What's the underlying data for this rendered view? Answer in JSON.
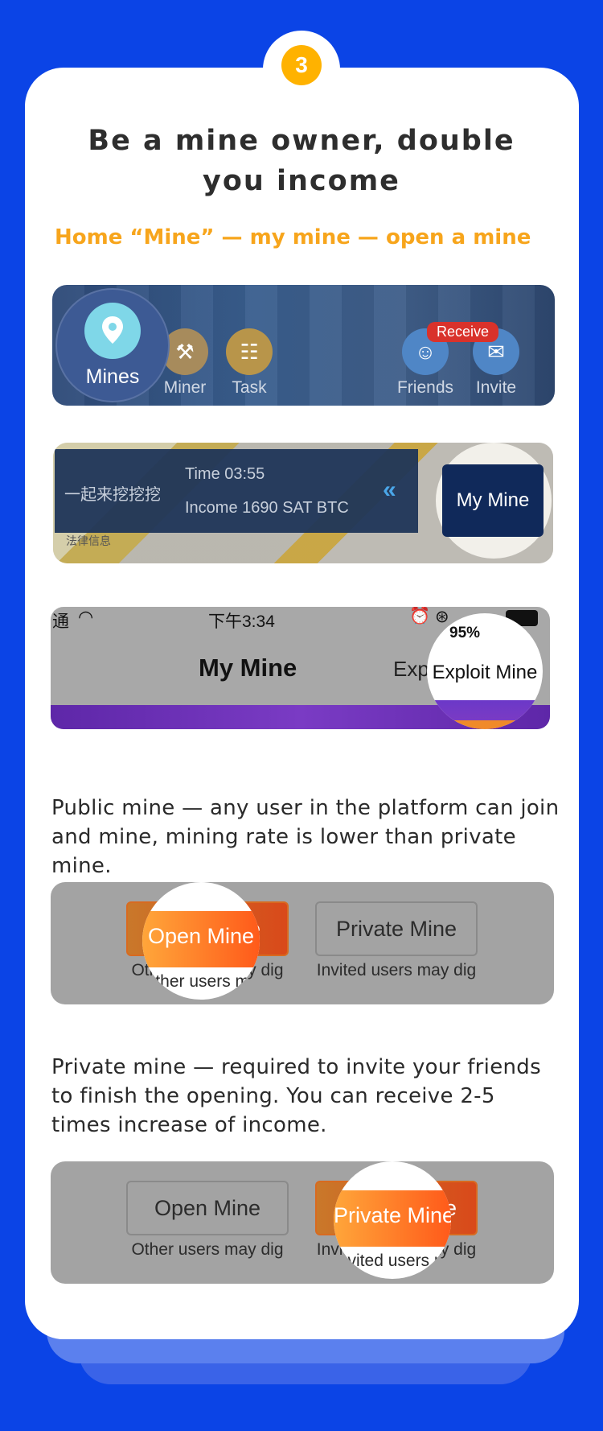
{
  "step": {
    "number": "3"
  },
  "title": "Be a mine owner, double you income",
  "path_hint": "Home “Mine” — my mine — open a mine",
  "nav_bar": {
    "mines": "Mines",
    "miner": "Miner",
    "task": "Task",
    "friends": "Friends",
    "invite": "Invite",
    "receive_badge": "Receive"
  },
  "map_panel": {
    "slogan": "一起来挖挖挖",
    "time": "Time 03:55",
    "income": "Income 1690 SAT BTC",
    "legal": "法律信息",
    "my_mine_button": "My Mine"
  },
  "my_mine_header": {
    "status_carrier": "通",
    "status_time": "下午3:34",
    "battery": "95%",
    "title": "My Mine",
    "exploit_ghost": "Exp",
    "exploit_button": "Exploit Mine"
  },
  "public_desc": "Public mine — any user in the platform can join and mine, mining rate is lower than private mine.",
  "private_desc": "Private mine — required to invite your friends to finish the opening. You can receive 2-5 times increase of income.",
  "choice_public": {
    "open_mine": "Open Mine",
    "open_mine_sub": "Other users may dig",
    "private_mine": "Private Mine",
    "private_mine_sub": "Invited users may dig",
    "spot_label": "Open Mine",
    "spot_sub": "Other users may"
  },
  "choice_private": {
    "open_mine": "Open Mine",
    "open_mine_sub": "Other users may dig",
    "private_mine": "Private Mine",
    "private_mine_sub": "Invited users may dig",
    "spot_label": "Private Mine",
    "spot_sub": "Invited users may"
  },
  "colors": {
    "background": "#0b44e6",
    "accent": "#f7a51c",
    "card": "#ffffff"
  }
}
